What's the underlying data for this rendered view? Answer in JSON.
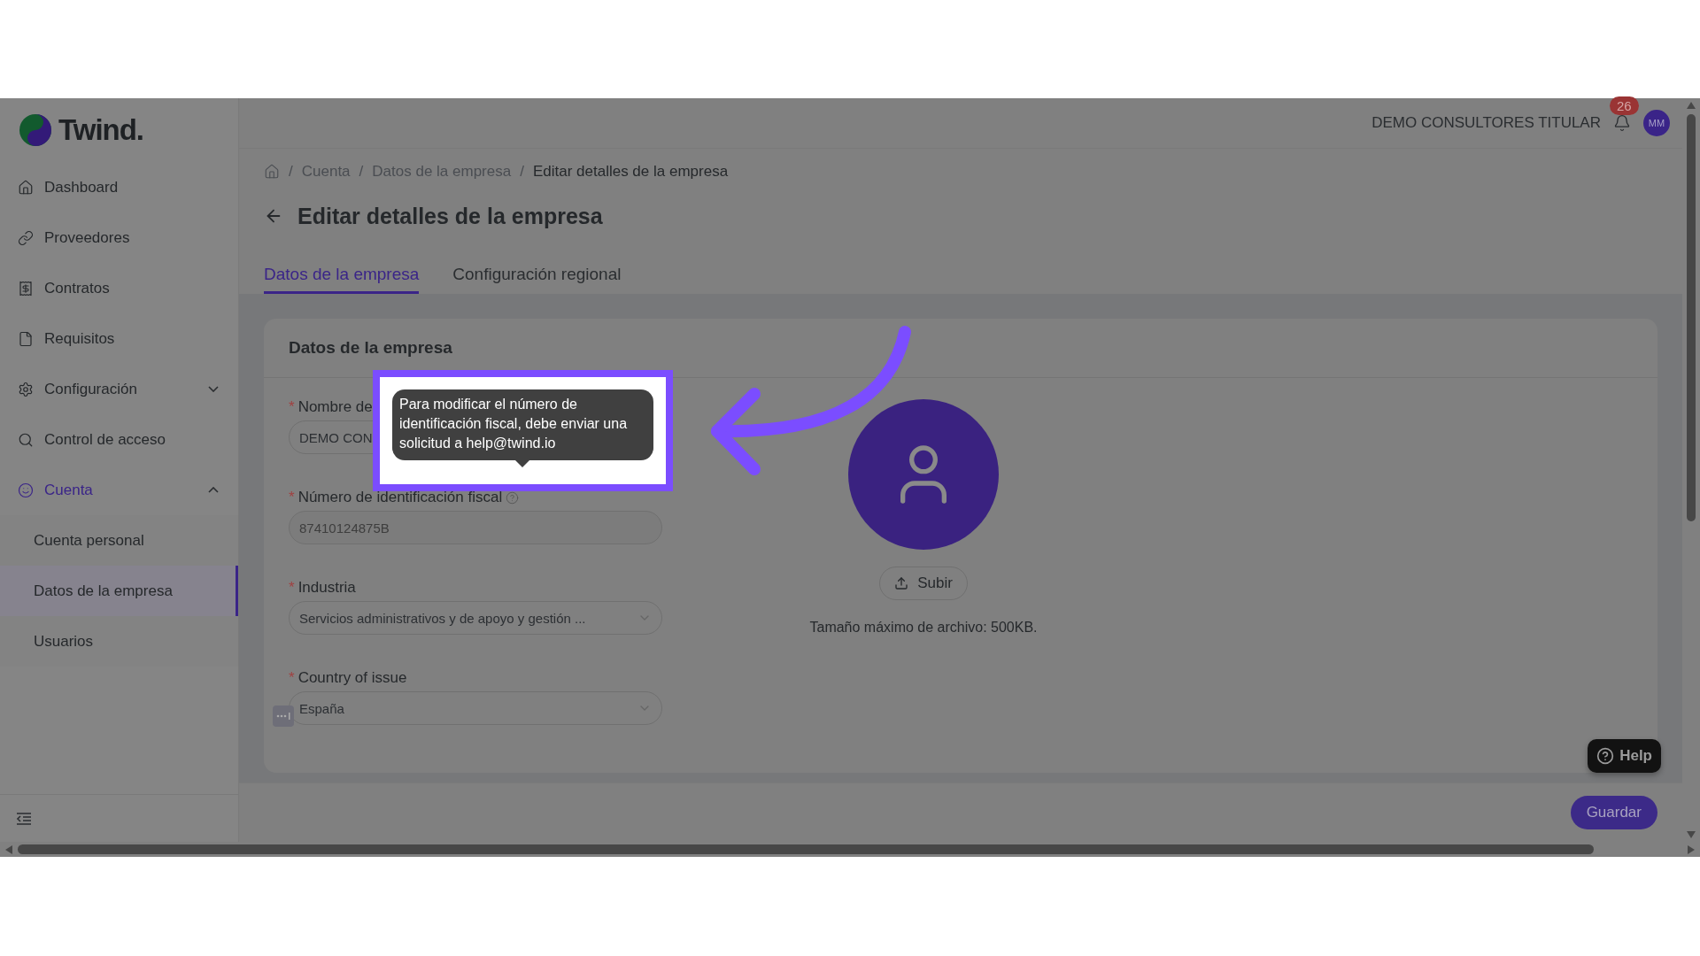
{
  "brand": {
    "name": "Twind."
  },
  "sidebar": {
    "items": [
      {
        "label": "Dashboard",
        "selected": false
      },
      {
        "label": "Proveedores",
        "selected": false
      },
      {
        "label": "Contratos",
        "selected": false
      },
      {
        "label": "Requisitos",
        "selected": false
      },
      {
        "label": "Configuración",
        "selected": false,
        "expanded": false
      },
      {
        "label": "Control de acceso",
        "selected": false
      },
      {
        "label": "Cuenta",
        "selected": true,
        "expanded": true,
        "children": [
          {
            "label": "Cuenta personal",
            "selected": false
          },
          {
            "label": "Datos de la empresa",
            "selected": true
          },
          {
            "label": "Usuarios",
            "selected": false
          }
        ]
      }
    ]
  },
  "header": {
    "company": "DEMO CONSULTORES TITULAR",
    "notifications": "26",
    "avatar": "MM"
  },
  "breadcrumb": [
    {
      "sep": "/",
      "label": "Cuenta",
      "current": false
    },
    {
      "sep": "/",
      "label": "Datos de la empresa",
      "current": false
    },
    {
      "sep": "/",
      "label": "Editar detalles de la empresa",
      "current": true
    }
  ],
  "title": "Editar detalles de la empresa",
  "tabs": [
    {
      "label": "Datos de la empresa",
      "selected": true
    },
    {
      "label": "Configuración regional",
      "selected": false
    }
  ],
  "card": {
    "title": "Datos de la empresa",
    "fields": [
      {
        "kind": "input",
        "mark": "*",
        "label": "Nombre de",
        "value": "DEMO CON",
        "disabled": false
      },
      {
        "kind": "input",
        "mark": "*",
        "label": "Número de identificación fiscal",
        "help": true,
        "value": "87410124875B",
        "disabled": true
      },
      {
        "kind": "select",
        "mark": "*",
        "label": "Industria",
        "value": "Servicios administrativos y de apoyo y gestión ..."
      },
      {
        "kind": "select",
        "mark": "*",
        "label": "Country of issue",
        "value": "España",
        "flag": true
      }
    ],
    "logo": {
      "button": "Subir",
      "note": "Tamaño máximo de archivo: 500KB."
    }
  },
  "tooltip": {
    "text": "Para modificar el número de identificación fiscal, debe enviar una solicitud a help@twind.io"
  },
  "help": "Help",
  "save": "Guardar"
}
